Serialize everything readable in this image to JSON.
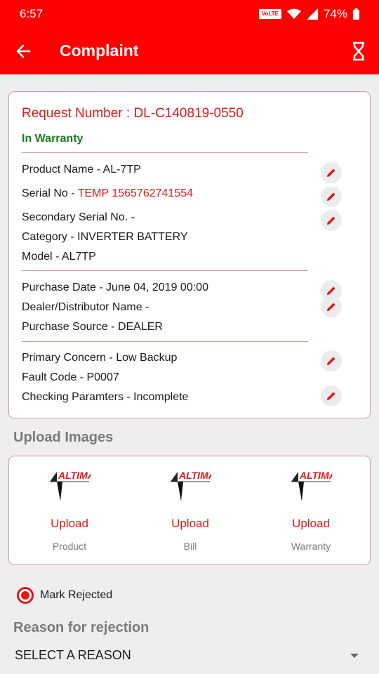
{
  "status_bar": {
    "time": "6:57",
    "volte_label": "VoLTE",
    "battery": "74%"
  },
  "app_bar": {
    "title": "Complaint",
    "back_icon": "arrow-left-icon",
    "action_icon": "hourglass-icon"
  },
  "details": {
    "request_number": "Request Number : DL-C140819-0550",
    "warranty_status": "In Warranty",
    "warranty_color": "#1a7a1a",
    "product_name": "Product Name - AL-7TP",
    "serial_no_label": "Serial No - ",
    "serial_no_value": "TEMP 1565762741554",
    "secondary_serial": "Secondary Serial No. -",
    "category": "Category - INVERTER BATTERY",
    "model": "Model - AL7TP",
    "purchase_date": "Purchase Date - June 04, 2019 00:00",
    "dealer_name": "Dealer/Distributor Name -",
    "purchase_source": "Purchase Source - DEALER",
    "primary_concern": "Primary Concern - Low Backup",
    "fault_code": "Fault Code - P0007",
    "checking_parameters": "Checking Paramters - Incomplete"
  },
  "upload_section": {
    "title": "Upload Images",
    "items": [
      {
        "logo": "ALTIMA",
        "action": "Upload",
        "label": "Product"
      },
      {
        "logo": "ALTIMA",
        "action": "Upload",
        "label": "Bill"
      },
      {
        "logo": "ALTIMA",
        "action": "Upload",
        "label": "Warranty"
      }
    ]
  },
  "rejection": {
    "radio_label": "Mark Rejected",
    "radio_checked": true,
    "reason_title": "Reason for rejection",
    "select_value": "SELECT A REASON"
  },
  "colors": {
    "brand": "#ff0000",
    "accent_text": "#d81b1b",
    "background": "#eeeeee"
  }
}
